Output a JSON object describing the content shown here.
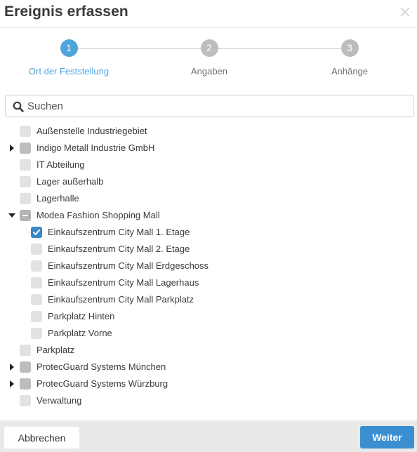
{
  "dialog": {
    "title": "Ereignis erfassen",
    "close_icon": "close-icon"
  },
  "stepper": {
    "accent_color": "#4ea5dc",
    "steps": [
      {
        "number": "1",
        "label": "Ort der Feststellung",
        "active": true
      },
      {
        "number": "2",
        "label": "Angaben",
        "active": false
      },
      {
        "number": "3",
        "label": "Anhänge",
        "active": false
      }
    ]
  },
  "search": {
    "placeholder": "Suchen",
    "value": "",
    "icon": "search-icon"
  },
  "tree": {
    "items": [
      {
        "label": "Außenstelle Industriegebiet",
        "level": 0,
        "expandable": false,
        "state": "unchecked"
      },
      {
        "label": "Indigo Metall Industrie GmbH",
        "level": 0,
        "expandable": true,
        "expanded": false,
        "state": "partial-gray"
      },
      {
        "label": "IT Abteilung",
        "level": 0,
        "expandable": false,
        "state": "unchecked"
      },
      {
        "label": "Lager außerhalb",
        "level": 0,
        "expandable": false,
        "state": "unchecked"
      },
      {
        "label": "Lagerhalle",
        "level": 0,
        "expandable": false,
        "state": "unchecked"
      },
      {
        "label": "Modea Fashion Shopping Mall",
        "level": 0,
        "expandable": true,
        "expanded": true,
        "state": "partial"
      },
      {
        "label": "Einkaufszentrum City Mall 1. Etage",
        "level": 1,
        "expandable": false,
        "state": "checked"
      },
      {
        "label": "Einkaufszentrum City Mall 2. Etage",
        "level": 1,
        "expandable": false,
        "state": "unchecked"
      },
      {
        "label": "Einkaufszentrum City Mall Erdgeschoss",
        "level": 1,
        "expandable": false,
        "state": "unchecked"
      },
      {
        "label": "Einkaufszentrum City Mall Lagerhaus",
        "level": 1,
        "expandable": false,
        "state": "unchecked"
      },
      {
        "label": "Einkaufszentrum City Mall Parkplatz",
        "level": 1,
        "expandable": false,
        "state": "unchecked"
      },
      {
        "label": "Parkplatz Hinten",
        "level": 1,
        "expandable": false,
        "state": "unchecked"
      },
      {
        "label": "Parkplatz Vorne",
        "level": 1,
        "expandable": false,
        "state": "unchecked"
      },
      {
        "label": "Parkplatz",
        "level": 0,
        "expandable": false,
        "state": "unchecked"
      },
      {
        "label": "ProtecGuard Systems München",
        "level": 0,
        "expandable": true,
        "expanded": false,
        "state": "partial-gray"
      },
      {
        "label": "ProtecGuard Systems Würzburg",
        "level": 0,
        "expandable": true,
        "expanded": false,
        "state": "partial-gray"
      },
      {
        "label": "Verwaltung",
        "level": 0,
        "expandable": false,
        "state": "unchecked"
      }
    ]
  },
  "footer": {
    "cancel_label": "Abbrechen",
    "next_label": "Weiter",
    "next_color": "#3b8fd0"
  }
}
